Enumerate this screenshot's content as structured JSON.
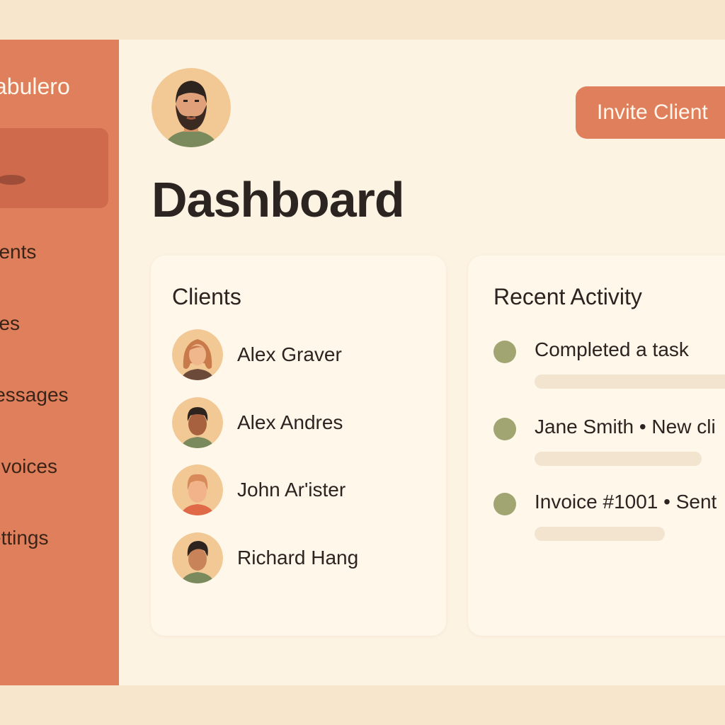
{
  "sidebar": {
    "brand": "abulero",
    "items": [
      {
        "label": "lients"
      },
      {
        "label": "iles"
      },
      {
        "label": "lessages"
      },
      {
        "label": "nvoices"
      },
      {
        "label": "ettings"
      }
    ]
  },
  "header": {
    "invite_label": "Invite Client"
  },
  "page": {
    "title": "Dashboard"
  },
  "clients": {
    "title": "Clients",
    "items": [
      {
        "name": "Alex Graver"
      },
      {
        "name": "Alex Andres"
      },
      {
        "name": "John Ar'ister"
      },
      {
        "name": "Richard Hang"
      }
    ]
  },
  "activity": {
    "title": "Recent Activity",
    "items": [
      {
        "text": "Completed a task"
      },
      {
        "text": "Jane Smith • New cli"
      },
      {
        "text": "Invoice #1001 • Sent"
      }
    ]
  },
  "colors": {
    "sidebar": "#e07f5b",
    "accent": "#e07f5b",
    "background": "#fdf3e3",
    "status_dot": "#a1a571"
  }
}
